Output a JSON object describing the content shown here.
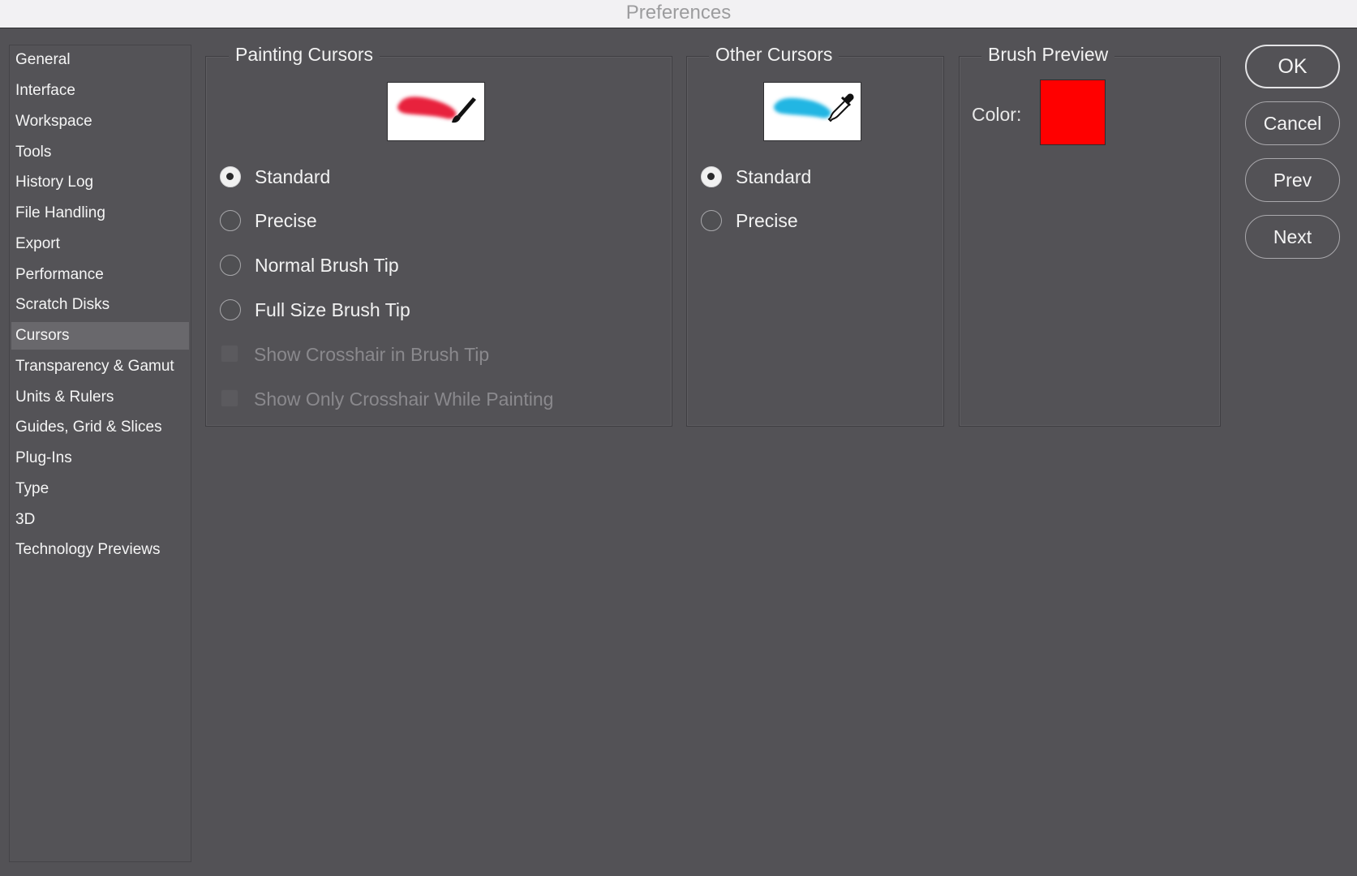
{
  "window": {
    "title": "Preferences"
  },
  "sidebar": {
    "items": [
      {
        "label": "General"
      },
      {
        "label": "Interface"
      },
      {
        "label": "Workspace"
      },
      {
        "label": "Tools"
      },
      {
        "label": "History Log"
      },
      {
        "label": "File Handling"
      },
      {
        "label": "Export"
      },
      {
        "label": "Performance"
      },
      {
        "label": "Scratch Disks"
      },
      {
        "label": "Cursors",
        "selected": true
      },
      {
        "label": "Transparency & Gamut"
      },
      {
        "label": "Units & Rulers"
      },
      {
        "label": "Guides, Grid & Slices"
      },
      {
        "label": "Plug-Ins"
      },
      {
        "label": "Type"
      },
      {
        "label": "3D"
      },
      {
        "label": "Technology Previews"
      }
    ]
  },
  "painting_cursors": {
    "title": "Painting Cursors",
    "preview_icon": "paintbrush-icon",
    "stroke_color": "#e8243c",
    "selected_option": "Standard",
    "options": [
      {
        "label": "Standard"
      },
      {
        "label": "Precise"
      },
      {
        "label": "Normal Brush Tip"
      },
      {
        "label": "Full Size Brush Tip"
      }
    ],
    "checkboxes": [
      {
        "label": "Show Crosshair in Brush Tip",
        "checked": false,
        "enabled": false
      },
      {
        "label": "Show Only Crosshair While Painting",
        "checked": false,
        "enabled": false
      }
    ]
  },
  "other_cursors": {
    "title": "Other Cursors",
    "preview_icon": "eyedropper-icon",
    "stroke_color": "#22b6e3",
    "selected_option": "Standard",
    "options": [
      {
        "label": "Standard"
      },
      {
        "label": "Precise"
      }
    ]
  },
  "brush_preview": {
    "title": "Brush Preview",
    "color_label": "Color:",
    "color": "#ff0000"
  },
  "buttons": {
    "ok": "OK",
    "cancel": "Cancel",
    "prev": "Prev",
    "next": "Next"
  }
}
